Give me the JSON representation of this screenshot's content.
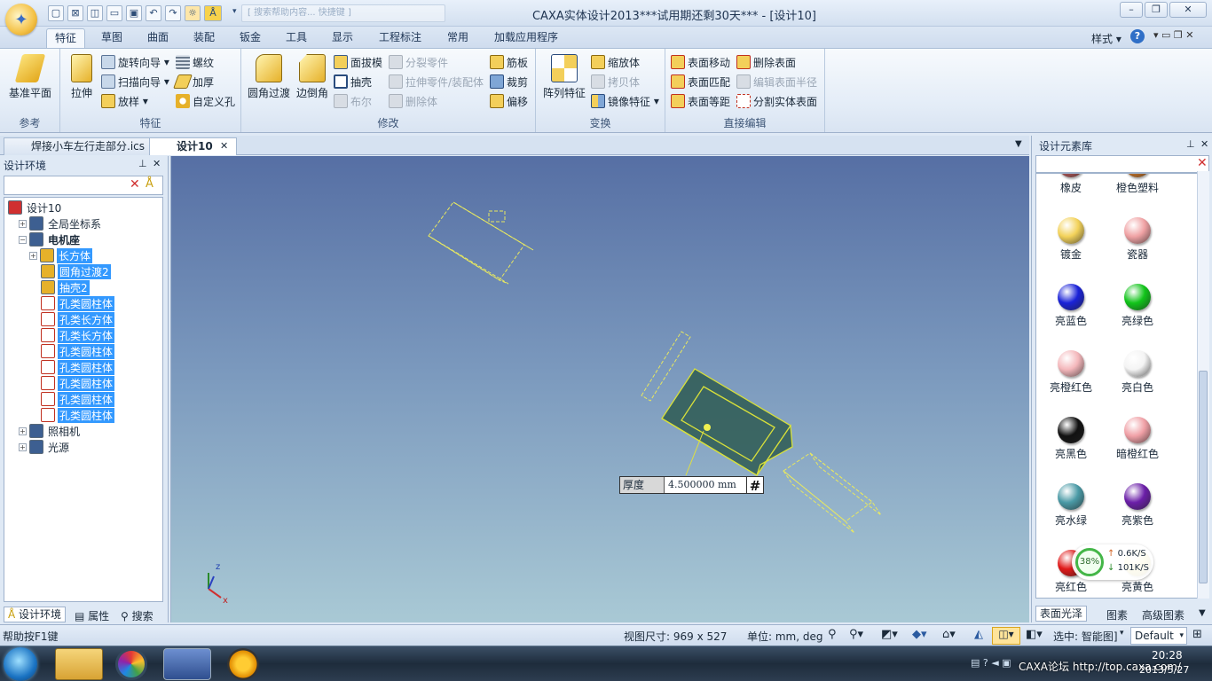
{
  "title_bar": {
    "window_title": "CAXA实体设计2013***试用期还剩30天*** - [设计10]",
    "qat_search_text": "[ 搜索帮助内容... 快捷键 ]",
    "style_label": "样式"
  },
  "ribbon_tabs": [
    "特征",
    "草图",
    "曲面",
    "装配",
    "钣金",
    "工具",
    "显示",
    "工程标注",
    "常用",
    "加载应用程序"
  ],
  "ribbon": {
    "ref": {
      "big": "基准平面",
      "title": "参考"
    },
    "feature": {
      "big": "拉伸",
      "items": [
        "旋转向导",
        "扫描向导",
        "放样",
        "螺纹",
        "加厚",
        "自定义孔"
      ],
      "title": "特征"
    },
    "modify": {
      "big1": "圆角过渡",
      "big2": "边倒角",
      "items": [
        "面拔模",
        "抽壳",
        "布尔",
        "分裂零件",
        "拉伸零件/装配体",
        "删除体",
        "筋板",
        "裁剪",
        "偏移"
      ],
      "title": "修改"
    },
    "transform": {
      "big": "阵列特征",
      "items": [
        "缩放体",
        "拷贝体",
        "镜像特征"
      ],
      "title": "变换"
    },
    "direct": {
      "items": [
        "表面移动",
        "表面匹配",
        "表面等距",
        "删除表面",
        "编辑表面半径",
        "分割实体表面"
      ],
      "title": "直接编辑"
    }
  },
  "doc_tabs": [
    "焊接小车左行走部分.ics",
    "设计10"
  ],
  "left_panel": {
    "title": "设计环境",
    "tree": [
      {
        "label": "设计10",
        "level": 0,
        "selected": false
      },
      {
        "label": "全局坐标系",
        "level": 1,
        "selected": false
      },
      {
        "label": "电机座",
        "level": 1,
        "selected": false
      },
      {
        "label": "长方体",
        "level": 2,
        "selected": true
      },
      {
        "label": "圆角过渡2",
        "level": 2,
        "selected": true
      },
      {
        "label": "抽壳2",
        "level": 2,
        "selected": true
      },
      {
        "label": "孔类圆柱体",
        "level": 2,
        "selected": true
      },
      {
        "label": "孔类长方体",
        "level": 2,
        "selected": true
      },
      {
        "label": "孔类长方体",
        "level": 2,
        "selected": true
      },
      {
        "label": "孔类圆柱体",
        "level": 2,
        "selected": true
      },
      {
        "label": "孔类圆柱体",
        "level": 2,
        "selected": true
      },
      {
        "label": "孔类圆柱体",
        "level": 2,
        "selected": true
      },
      {
        "label": "孔类圆柱体",
        "level": 2,
        "selected": true
      },
      {
        "label": "孔类圆柱体",
        "level": 2,
        "selected": true
      },
      {
        "label": "照相机",
        "level": 1,
        "selected": false
      },
      {
        "label": "光源",
        "level": 1,
        "selected": false
      }
    ],
    "bottom_tabs": [
      "设计环境",
      "属性",
      "搜索"
    ]
  },
  "viewport": {
    "thickness_label": "厚度",
    "thickness_value": "4.500000 mm",
    "hash": "#",
    "axis_z": "z",
    "axis_x": "x"
  },
  "right_panel": {
    "title": "设计元素库",
    "materials": [
      {
        "name": "橡皮",
        "color": "#b65a5a"
      },
      {
        "name": "橙色塑料",
        "color": "#d07a2a"
      },
      {
        "name": "镀金",
        "color": "#f3d25a"
      },
      {
        "name": "瓷器",
        "color": "#f0a2a4"
      },
      {
        "name": "亮蓝色",
        "color": "#1a22d8"
      },
      {
        "name": "亮绿色",
        "color": "#11c41a"
      },
      {
        "name": "亮橙红色",
        "color": "#f4b7bb"
      },
      {
        "name": "亮白色",
        "color": "#f4f4f4"
      },
      {
        "name": "亮黑色",
        "color": "#111111"
      },
      {
        "name": "暗橙红色",
        "color": "#f0a0a6"
      },
      {
        "name": "亮水绿",
        "color": "#4a9aa6"
      },
      {
        "name": "亮紫色",
        "color": "#6b1fa8"
      },
      {
        "name": "亮红色",
        "color": "#e01818"
      },
      {
        "name": "亮黄色",
        "color": "#eedc3a"
      }
    ],
    "bottom_tabs": [
      "表面光泽",
      "图素",
      "高级图素"
    ]
  },
  "net_widget": {
    "percent": "38%",
    "up": "0.6K/S",
    "down": "101K/S"
  },
  "status": {
    "help": "帮助按F1键",
    "view_size": "视图尺寸: 969 x 527",
    "units": "单位: mm, deg",
    "select_label": "选中: 智能图]",
    "default": "Default"
  },
  "taskbar": {
    "time": "20:28",
    "date": "2013/5/27",
    "watermark": "CAXA论坛 http://top.caxa.com/"
  }
}
